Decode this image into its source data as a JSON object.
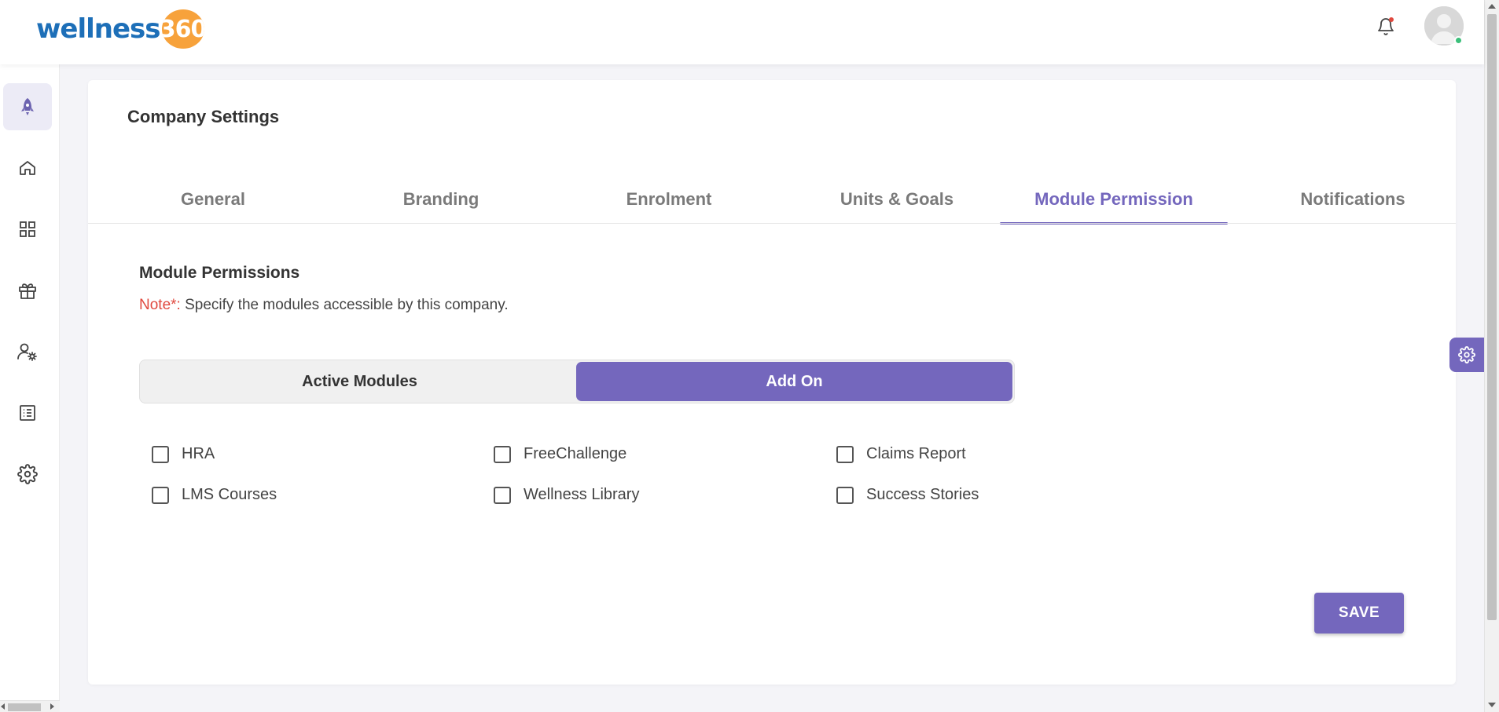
{
  "app": {
    "logo_text": "wellness",
    "logo_number": "360"
  },
  "header": {
    "bell_icon": "bell-icon",
    "avatar_icon": "user-avatar"
  },
  "sidebar": {
    "items": [
      {
        "name": "rocket",
        "icon": "rocket-icon",
        "active": true
      },
      {
        "name": "home",
        "icon": "home-icon"
      },
      {
        "name": "dashboard",
        "icon": "grid-icon"
      },
      {
        "name": "rewards",
        "icon": "gift-icon"
      },
      {
        "name": "user-settings",
        "icon": "user-gear-icon"
      },
      {
        "name": "reports",
        "icon": "list-icon"
      },
      {
        "name": "settings",
        "icon": "gear-icon"
      }
    ]
  },
  "page": {
    "title": "Company Settings"
  },
  "tabs": [
    {
      "label": "General"
    },
    {
      "label": "Branding"
    },
    {
      "label": "Enrolment"
    },
    {
      "label": "Units & Goals"
    },
    {
      "label": "Module Permission",
      "active": true
    },
    {
      "label": "Notifications"
    }
  ],
  "section": {
    "title": "Module Permissions",
    "note_label": "Note*:",
    "note_text": " Specify the modules accessible by this company."
  },
  "segment": {
    "left_label": "Active Modules",
    "right_label": "Add On",
    "selected": "Add On"
  },
  "modules": [
    {
      "label": "HRA",
      "checked": false
    },
    {
      "label": "FreeChallenge",
      "checked": false
    },
    {
      "label": "Claims Report",
      "checked": false
    },
    {
      "label": "LMS Courses",
      "checked": false
    },
    {
      "label": "Wellness Library",
      "checked": false
    },
    {
      "label": "Success Stories",
      "checked": false
    }
  ],
  "actions": {
    "save_label": "SAVE"
  },
  "colors": {
    "accent": "#7467bd",
    "note_red": "#e0483e",
    "logo_blue": "#1d6fb8",
    "logo_orange": "#f7a23b"
  }
}
